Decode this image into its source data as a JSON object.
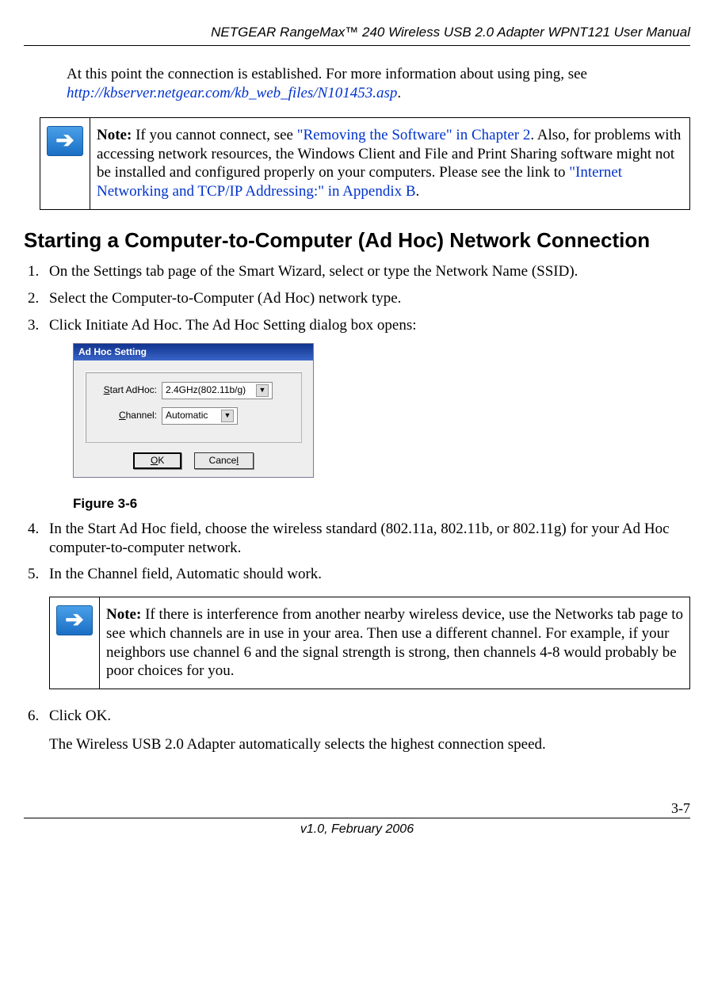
{
  "header": {
    "title": "NETGEAR RangeMax™ 240 Wireless USB 2.0 Adapter WPNT121 User Manual"
  },
  "intro": {
    "prefix": "At this point the connection is established. For more information about using ping, see ",
    "link": "http://kbserver.netgear.com/kb_web_files/N101453.asp",
    "suffix": "."
  },
  "note1": {
    "bold": "Note:",
    "t1": " If you cannot connect, see ",
    "link1": "\"Removing the Software\" in Chapter 2",
    "t2": ". Also, for problems with accessing network resources, the Windows Client and File and Print Sharing software might not be installed and configured properly on your computers. Please see the link to ",
    "link2": "\"Internet Networking and TCP/IP Addressing:\" in Appendix B",
    "t3": "."
  },
  "heading": "Starting a Computer-to-Computer (Ad Hoc) Network Connection",
  "steps": {
    "s1": "On the Settings tab page of the Smart Wizard, select or type the Network Name (SSID).",
    "s2": "Select the Computer-to-Computer (Ad Hoc) network type.",
    "s3": "Click Initiate Ad Hoc. The Ad Hoc Setting dialog box opens:",
    "s4": "In the Start Ad Hoc field, choose the wireless standard (802.11a, 802.11b, or 802.11g) for your Ad Hoc computer-to-computer network.",
    "s5": "In the Channel field, Automatic should work.",
    "s6": "Click OK.",
    "s6b": "The Wireless USB 2.0 Adapter automatically selects the highest connection speed."
  },
  "dialog": {
    "title": "Ad Hoc Setting",
    "label_start_pre": "S",
    "label_start_post": "tart AdHoc:",
    "start_value": "2.4GHz(802.11b/g)",
    "label_channel_pre": "C",
    "label_channel_post": "hannel:",
    "channel_value": "Automatic",
    "ok_pre": "O",
    "ok_post": "K",
    "ok_under": "O",
    "cancel_pre": "Cance",
    "cancel_under": "l"
  },
  "figcaption": "Figure 3-6",
  "note2": {
    "bold": "Note:",
    "text": " If there is interference from another nearby wireless device, use the Networks tab page to see which channels are in use in your area. Then use a different channel. For example, if your neighbors use channel 6 and the signal strength is strong, then channels 4-8 would probably be poor choices for you."
  },
  "footer": {
    "version": "v1.0, February 2006",
    "pagenum": "3-7"
  }
}
